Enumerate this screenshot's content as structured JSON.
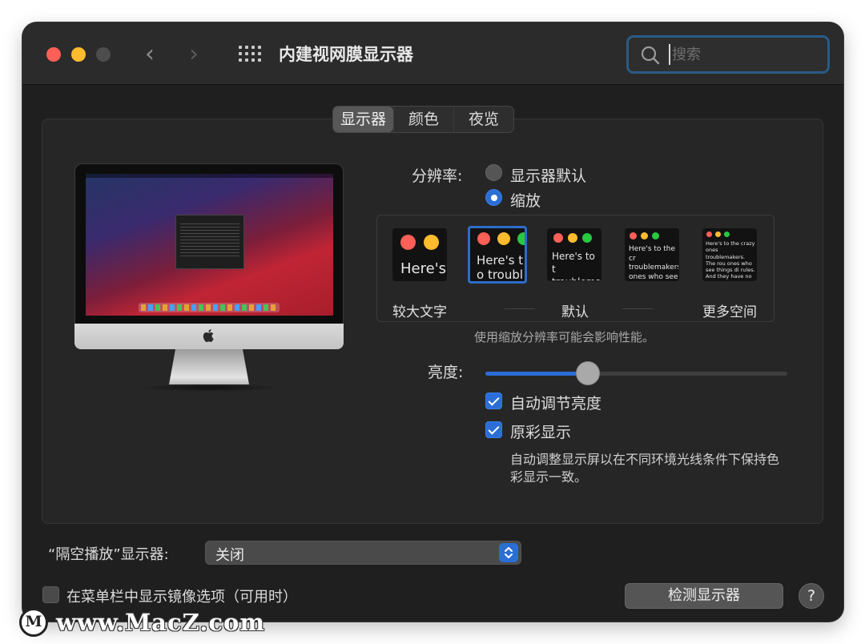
{
  "window": {
    "title": "内建视网膜显示器"
  },
  "search": {
    "placeholder": "搜索",
    "value": ""
  },
  "tabs": [
    {
      "label": "显示器",
      "active": true
    },
    {
      "label": "颜色"
    },
    {
      "label": "夜览"
    }
  ],
  "resolution": {
    "label": "分辨率:",
    "options": [
      {
        "label": "显示器默认",
        "selected": false
      },
      {
        "label": "缩放",
        "selected": true
      }
    ]
  },
  "scaling": {
    "labels": {
      "larger": "较大文字",
      "default": "默认",
      "more_space": "更多空间"
    },
    "previews": [
      {
        "text": "Here's"
      },
      {
        "text": "Here's to troublem",
        "selected": true
      },
      {
        "text": "Here's to t troublema ones who"
      },
      {
        "text": "Here's to the cr troublemakers. ones who see t rules. And they"
      },
      {
        "text": "Here's to the crazy ones troublemakers. The rou ones who see things di rules. And they have no can quote them, disagr them. About the only th Because they change th"
      }
    ],
    "note": "使用缩放分辨率可能会影响性能。"
  },
  "brightness": {
    "label": "亮度:",
    "level": 0.34
  },
  "auto_brightness": {
    "label": "自动调节亮度",
    "checked": true
  },
  "true_tone": {
    "label": "原彩显示",
    "checked": true,
    "description_line1": "自动调整显示屏以在不同环境光线条件下保持色",
    "description_line2": "彩显示一致。"
  },
  "airplay": {
    "label": "“隔空播放”显示器:",
    "value": "关闭"
  },
  "mirror_option": {
    "label": "在菜单栏中显示镜像选项（可用时）",
    "checked": false
  },
  "detect_button": {
    "label": "检测显示器"
  },
  "help_button": {
    "label": "?"
  },
  "watermark": {
    "text": "www.MacZ.com"
  },
  "colors": {
    "accent": "#2b6ed6",
    "red": "#fe5f57",
    "yellow": "#febc2e",
    "green": "#28c840"
  }
}
